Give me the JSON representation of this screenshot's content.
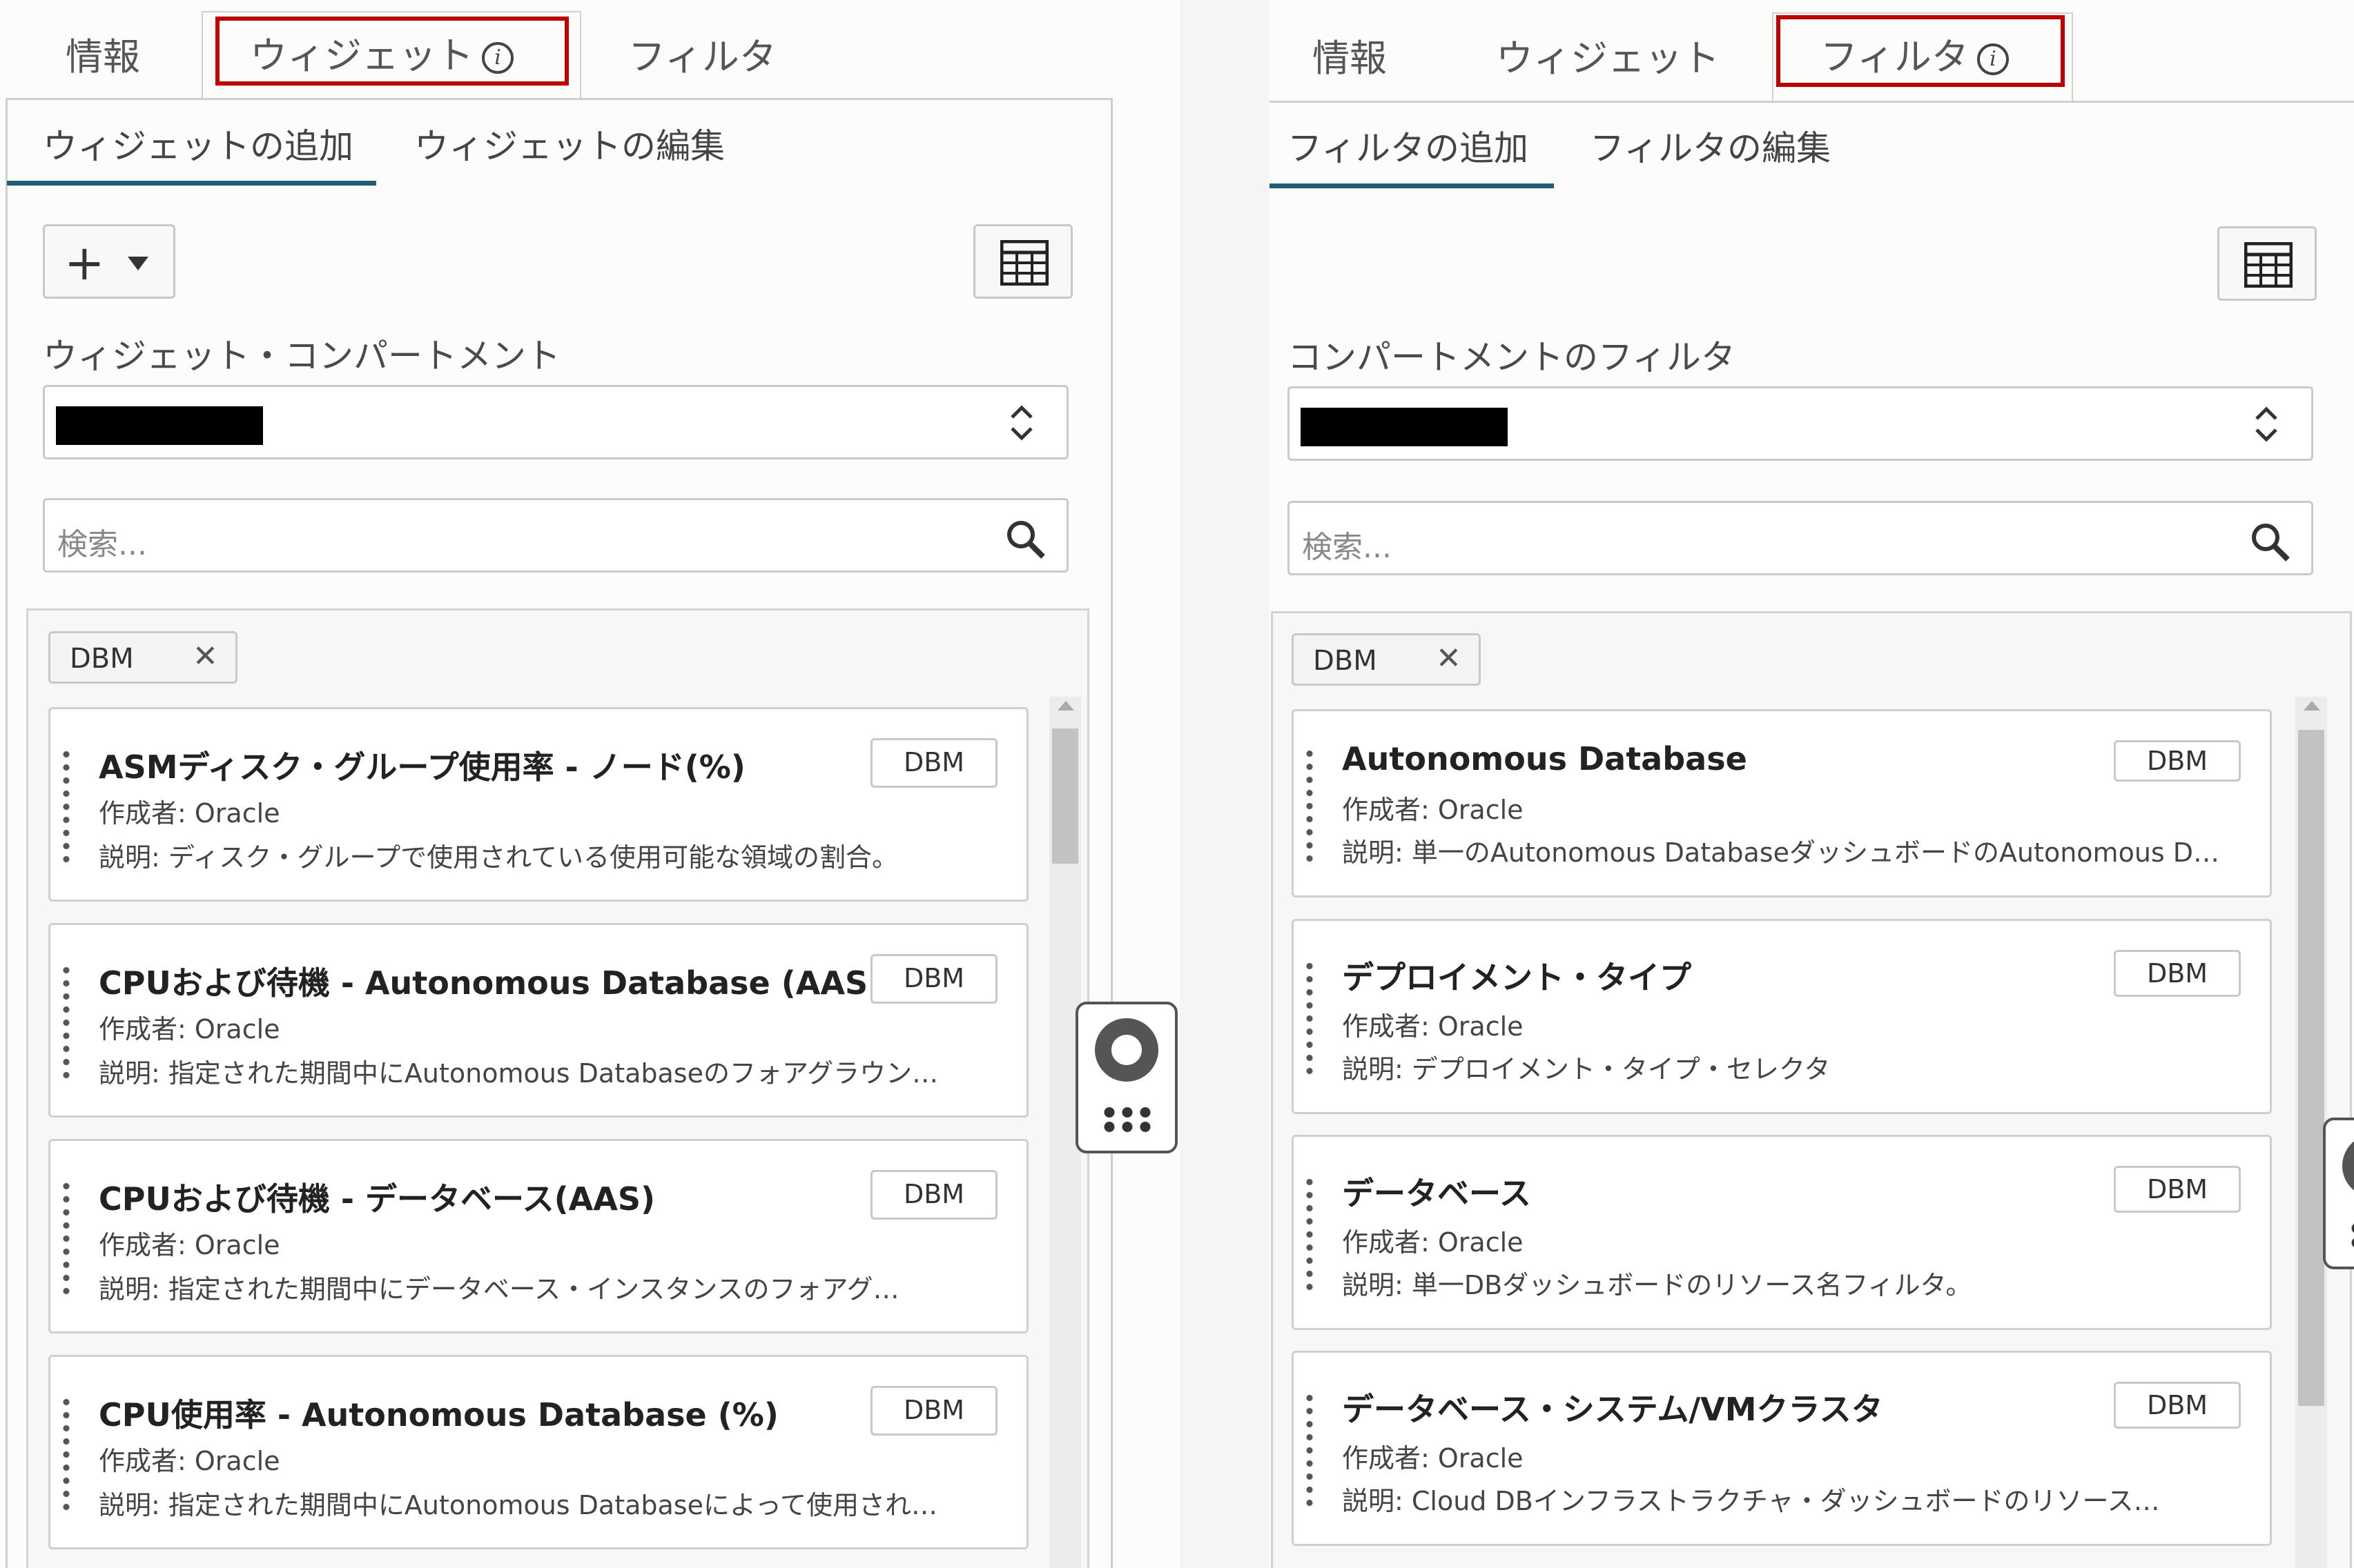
{
  "left": {
    "tabs": [
      "情報",
      "ウィジェット",
      "フィルタ"
    ],
    "active_tab": "ウィジェット",
    "subtabs": [
      "ウィジェットの追加",
      "ウィジェットの編集"
    ],
    "add_button_label": "+",
    "compartment_label": "ウィジェット・コンパートメント",
    "search_placeholder": "検索...",
    "filter_chip": "DBM",
    "cards": [
      {
        "title": "ASMディスク・グループ使用率 - ノード(%)",
        "author": "作成者: Oracle",
        "desc": "説明: ディスク・グループで使用されている使用可能な領域の割合。",
        "badge": "DBM"
      },
      {
        "title": "CPUおよび待機 - Autonomous Database (AAS)",
        "author": "作成者: Oracle",
        "desc": "説明: 指定された期間中にAutonomous Databaseのフォアグラウン…",
        "badge": "DBM"
      },
      {
        "title": "CPUおよび待機 - データベース(AAS)",
        "author": "作成者: Oracle",
        "desc": "説明: 指定された期間中にデータベース・インスタンスのフォアグ…",
        "badge": "DBM"
      },
      {
        "title": "CPU使用率 - Autonomous Database (%)",
        "author": "作成者: Oracle",
        "desc": "説明: 指定された期間中にAutonomous Databaseによって使用され…",
        "badge": "DBM"
      }
    ]
  },
  "right": {
    "tabs": [
      "情報",
      "ウィジェット",
      "フィルタ"
    ],
    "active_tab": "フィルタ",
    "subtabs": [
      "フィルタの追加",
      "フィルタの編集"
    ],
    "compartment_label": "コンパートメントのフィルタ",
    "search_placeholder": "検索...",
    "filter_chip": "DBM",
    "cards": [
      {
        "title": "Autonomous Database",
        "author": "作成者: Oracle",
        "desc": "説明: 単一のAutonomous DatabaseダッシュボードのAutonomous D…",
        "badge": "DBM"
      },
      {
        "title": "デプロイメント・タイプ",
        "author": "作成者: Oracle",
        "desc": "説明: デプロイメント・タイプ・セレクタ",
        "badge": "DBM"
      },
      {
        "title": "データベース",
        "author": "作成者: Oracle",
        "desc": "説明: 単一DBダッシュボードのリソース名フィルタ。",
        "badge": "DBM"
      },
      {
        "title": "データベース・システム/VMクラスタ",
        "author": "作成者: Oracle",
        "desc": "説明: Cloud DBインフラストラクチャ・ダッシュボードのリソース…",
        "badge": "DBM"
      }
    ]
  },
  "colors": {
    "highlight_border": "#c00000",
    "active_underline": "#1f5f7a"
  },
  "icons": [
    "info-icon",
    "plus-icon",
    "caret-down-icon",
    "grid-view-icon",
    "updown-chevron-icon",
    "search-icon",
    "close-icon",
    "drag-handle-icon",
    "lifebuoy-icon",
    "apps-dots-icon"
  ]
}
